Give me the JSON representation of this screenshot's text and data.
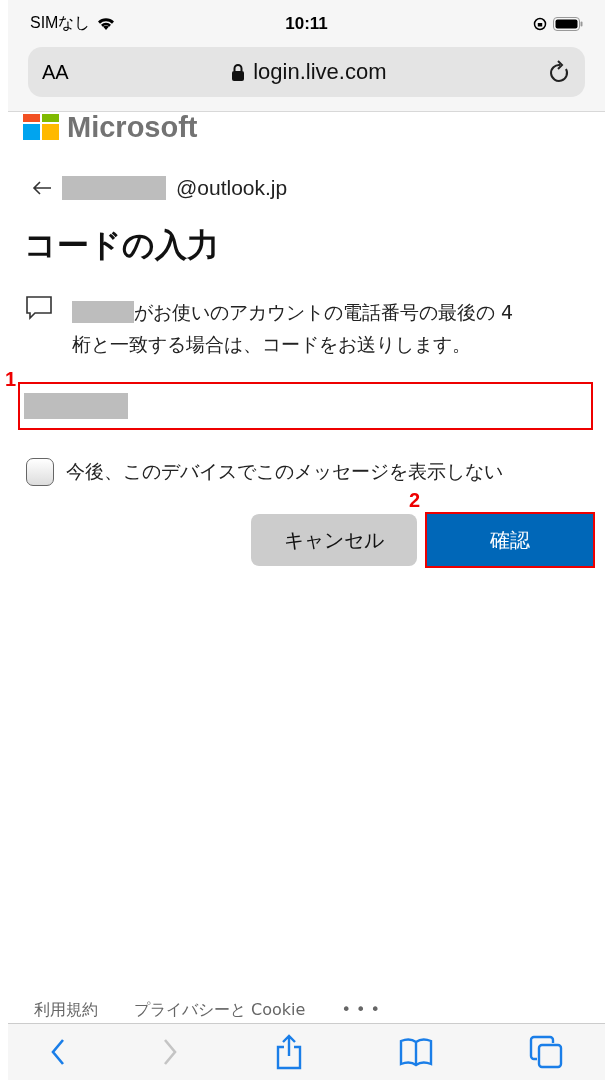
{
  "status_bar": {
    "carrier": "SIMなし",
    "time": "10:11"
  },
  "address_bar": {
    "text_size": "AA",
    "url": "login.live.com"
  },
  "brand": {
    "name": "Microsoft"
  },
  "account": {
    "email_suffix": "@outlook.jp"
  },
  "title": "コードの入力",
  "message_lines": [
    "がお使いのアカウントの電話番号の最後の 4",
    "桁と一致する場合は、コードをお送りします。"
  ],
  "code_field": {
    "annotation": "1"
  },
  "remember": {
    "label": "今後、このデバイスでこのメッセージを表示しない",
    "checked": false
  },
  "buttons": [
    {
      "label": "キャンセル",
      "kind": "secondary"
    },
    {
      "label": "確認",
      "kind": "primary",
      "annotation": "2"
    }
  ],
  "footer_links": [
    "利用規約",
    "プライバシーと Cookie",
    "• • •"
  ],
  "toolbar": [
    {
      "kind": "back",
      "disabled": false
    },
    {
      "kind": "forward",
      "disabled": true
    },
    {
      "kind": "share",
      "disabled": false
    },
    {
      "kind": "bookmarks",
      "disabled": false
    },
    {
      "kind": "tabs",
      "disabled": false
    }
  ]
}
